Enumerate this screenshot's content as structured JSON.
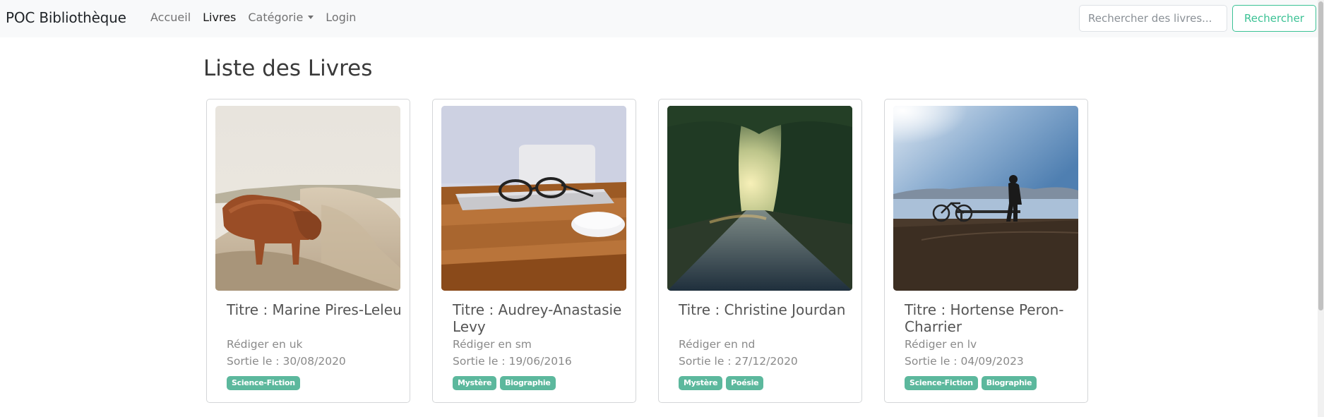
{
  "brand": "POC Bibliothèque",
  "nav": {
    "home": "Accueil",
    "books": "Livres",
    "category": "Catégorie",
    "login": "Login"
  },
  "search": {
    "placeholder": "Rechercher des livres...",
    "value": "",
    "button_label": "Rechercher"
  },
  "main": {
    "title": "Liste des Livres"
  },
  "books": [
    {
      "title": "Titre : Marine Pires-Leleu",
      "language": "Rédiger en uk",
      "release": "Sortie le : 30/08/2020",
      "tags": [
        "Science-Fiction"
      ]
    },
    {
      "title": "Titre : Audrey-Anastasie Levy",
      "language": "Rédiger en sm",
      "release": "Sortie le : 19/06/2016",
      "tags": [
        "Mystère",
        "Biographie"
      ]
    },
    {
      "title": "Titre : Christine Jourdan",
      "language": "Rédiger en nd",
      "release": "Sortie le : 27/12/2020",
      "tags": [
        "Mystère",
        "Poésie"
      ]
    },
    {
      "title": "Titre : Hortense Peron-Charrier",
      "language": "Rédiger en lv",
      "release": "Sortie le : 04/09/2023",
      "tags": [
        "Science-Fiction",
        "Biographie"
      ]
    }
  ],
  "colors": {
    "accent": "#3cc295",
    "tag_background": "#5cb89d",
    "navbar_background": "#f8f9fa"
  }
}
